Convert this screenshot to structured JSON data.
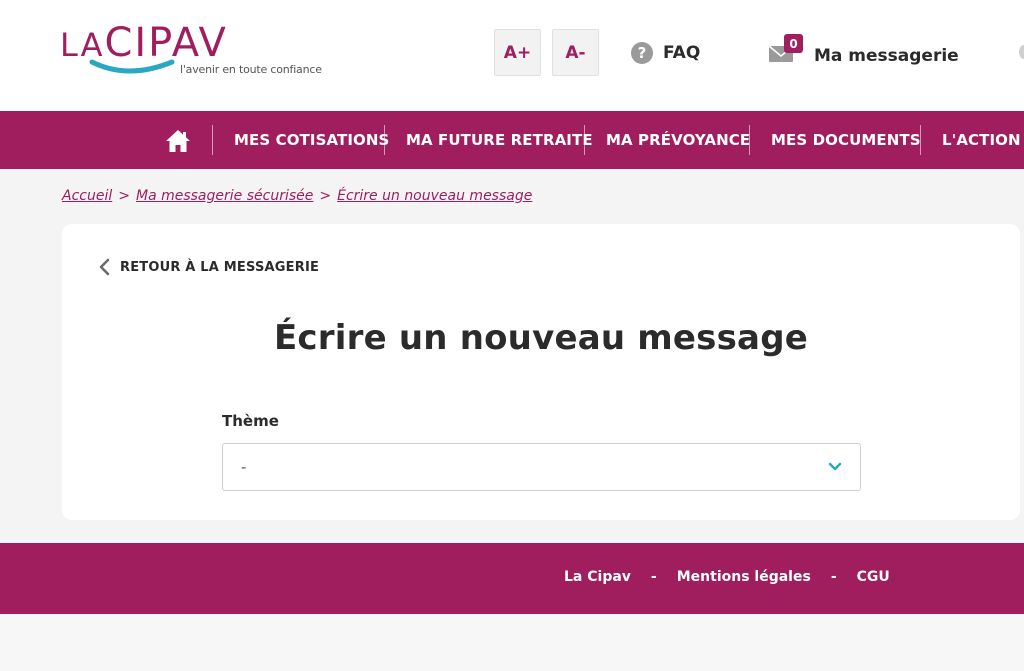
{
  "brand": {
    "logo_text_prefix": "LA",
    "logo_text_main": "CIPAV",
    "tagline": "l'avenir en toute confiance",
    "color": "#a01d5e"
  },
  "header": {
    "font_increase": "A+",
    "font_decrease": "A-",
    "faq_icon": "?",
    "faq_label": "FAQ",
    "messages_icon": "envelope-icon",
    "messages_count": "0",
    "messages_label": "Ma messagerie"
  },
  "nav": {
    "home_icon": "home-icon",
    "items": [
      {
        "label": "MES COTISATIONS"
      },
      {
        "label": "MA FUTURE RETRAITE"
      },
      {
        "label": "MA PRÉVOYANCE"
      },
      {
        "label": "MES DOCUMENTS"
      },
      {
        "label": "L'ACTION SOCIALE"
      }
    ]
  },
  "breadcrumb": {
    "items": [
      "Accueil",
      "Ma messagerie sécurisée",
      "Écrire un nouveau message"
    ],
    "separator": ">"
  },
  "card": {
    "back_label": "RETOUR À LA MESSAGERIE",
    "title": "Écrire un nouveau message",
    "theme_label": "Thème",
    "theme_value": "-"
  },
  "footer": {
    "links": [
      "La Cipav",
      "Mentions légales",
      "CGU"
    ],
    "separator": "-"
  }
}
